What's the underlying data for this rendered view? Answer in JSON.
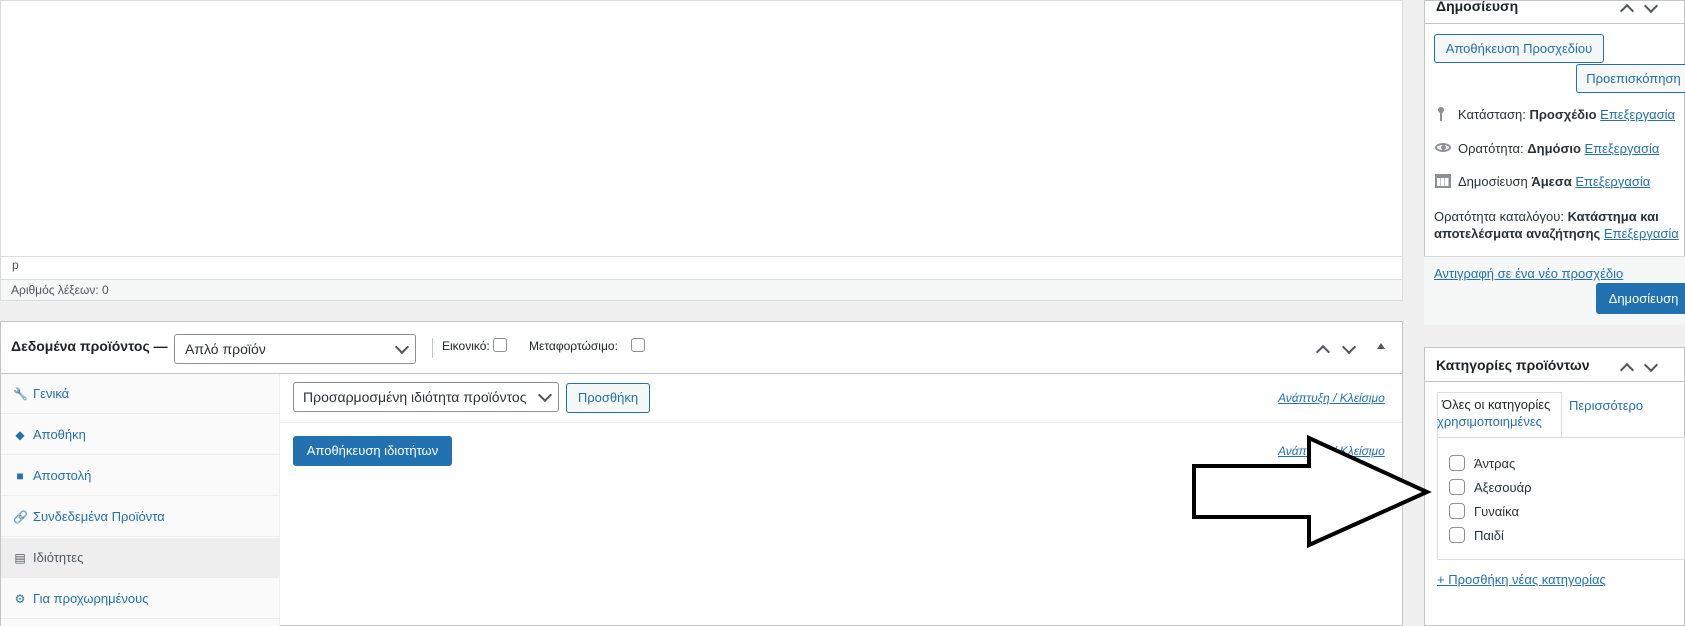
{
  "editor": {
    "path": "p",
    "word_count": "Αριθμός λέξεων: 0"
  },
  "product_data": {
    "title": "Δεδομένα προϊόντος —",
    "type_select": "Απλό προϊόν",
    "virtual_label": "Εικονικό:",
    "downloadable_label": "Μεταφορτώσιμο:",
    "tabs": [
      {
        "icon": "wrench-icon",
        "glyph": "🔧",
        "label": "Γενικά"
      },
      {
        "icon": "tag-icon",
        "glyph": "◆",
        "label": "Αποθήκη"
      },
      {
        "icon": "truck-icon",
        "glyph": "■",
        "label": "Αποστολή"
      },
      {
        "icon": "link-icon",
        "glyph": "🔗",
        "label": "Συνδεδεμένα Προϊόντα"
      },
      {
        "icon": "list-icon",
        "glyph": "▤",
        "label": "Ιδιότητες"
      },
      {
        "icon": "gear-icon",
        "glyph": "⚙",
        "label": "Για προχωρημένους"
      }
    ],
    "attributes": {
      "select": "Προσαρμοσμένη ιδιότητα προϊόντος",
      "add_button": "Προσθήκη",
      "expand_close": "Ανάπτυξη / Κλείσιμο",
      "expand_close_2": "Ανάπτυξη / Κλείσιμο",
      "save_button": "Αποθήκευση ιδιοτήτων"
    }
  },
  "publish": {
    "title": "Δημοσίευση",
    "save_draft": "Αποθήκευση Προσχεδίου",
    "preview": "Προεπισκόπηση",
    "status_label": "Κατάσταση:",
    "status_value": "Προσχέδιο",
    "visibility_label": "Ορατότητα:",
    "visibility_value": "Δημόσιο",
    "publish_label": "Δημοσίευση",
    "publish_value": "Άμεσα",
    "catalog_label": "Ορατότητα καταλόγου:",
    "catalog_value_1": "Κατάστημα και",
    "catalog_value_2": "αποτελέσματα αναζήτησης",
    "edit": "Επεξεργασία",
    "copy_draft": "Αντιγραφή σε ένα νέο προσχέδιο",
    "publish_button": "Δημοσίευση"
  },
  "categories": {
    "title": "Κατηγορίες προϊόντων",
    "tab_all": "Όλες οι κατηγορίες",
    "tab_most_used_1": "Περισσότερο",
    "tab_most_used_2": "χρησιμοποιημένες",
    "items": [
      "Άντρας",
      "Αξεσουάρ",
      "Γυναίκα",
      "Παιδί"
    ],
    "add_new": "+ Προσθήκη νέας κατηγορίας"
  },
  "colors": {
    "accent": "#2271b1",
    "arrow_stroke": "#000000"
  }
}
